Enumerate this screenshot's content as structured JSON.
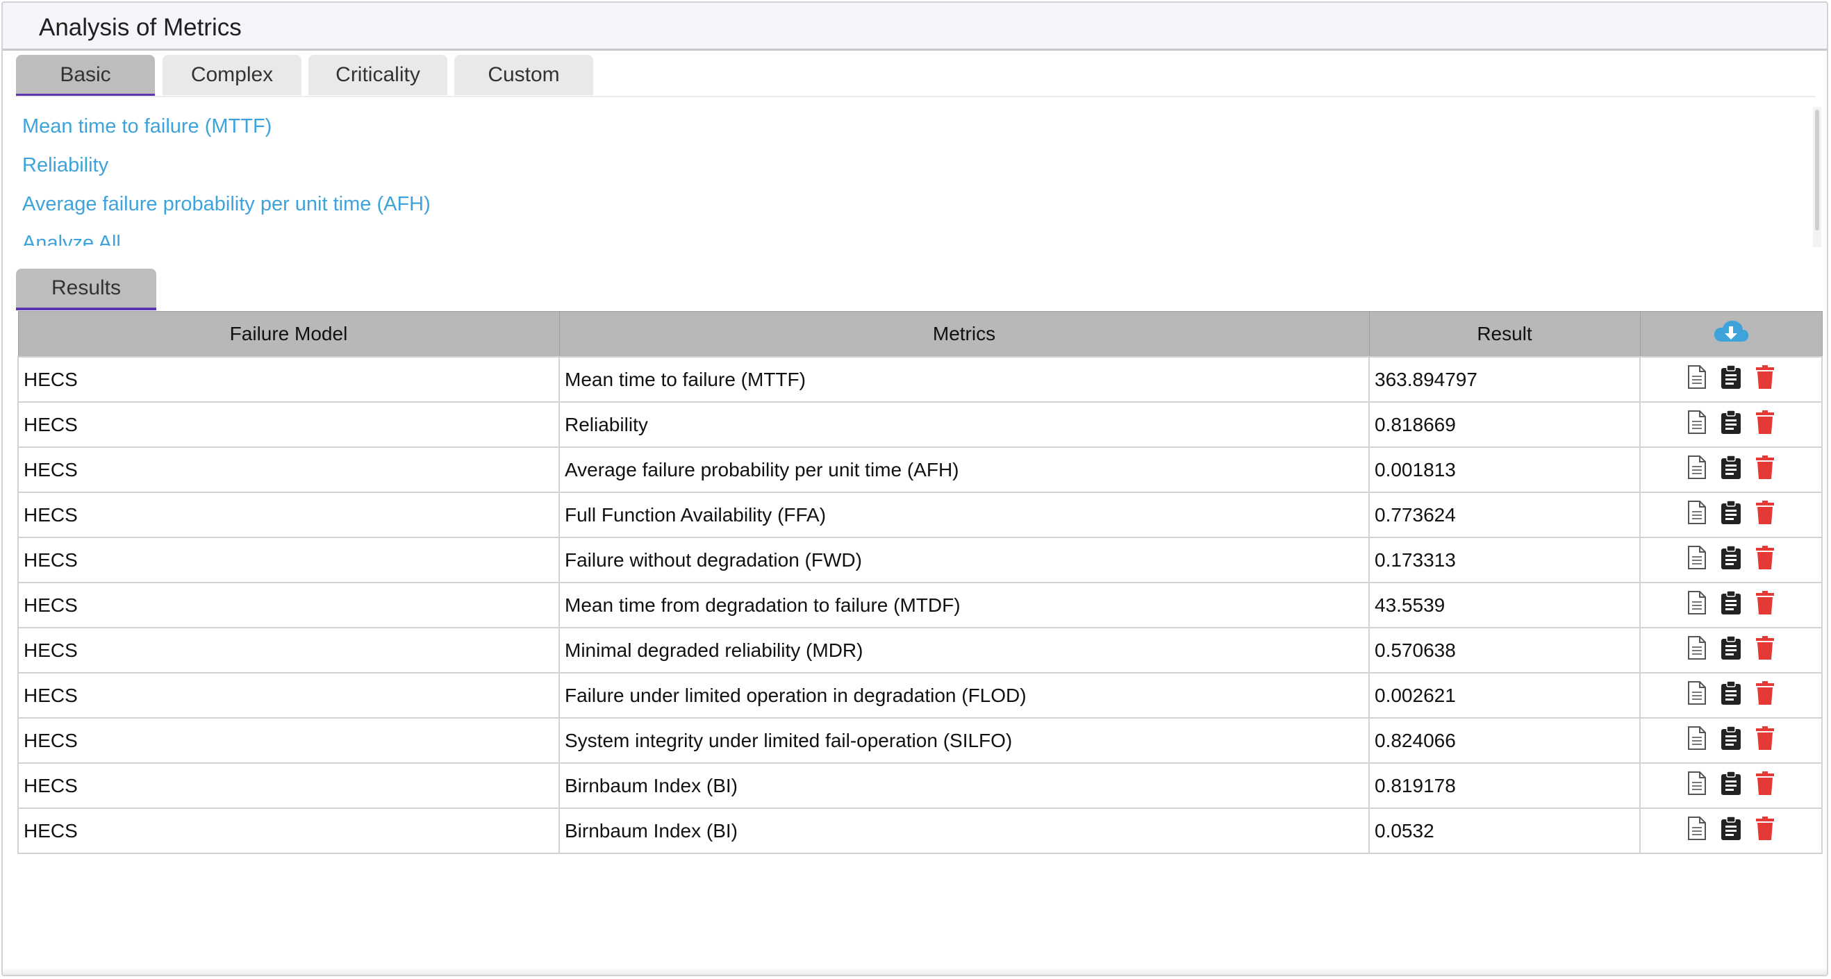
{
  "window": {
    "title": "Analysis of Metrics"
  },
  "tabs": [
    {
      "label": "Basic",
      "active": true
    },
    {
      "label": "Complex",
      "active": false
    },
    {
      "label": "Criticality",
      "active": false
    },
    {
      "label": "Custom",
      "active": false
    }
  ],
  "metric_links": [
    "Mean time to failure (MTTF)",
    "Reliability",
    "Average failure probability per unit time (AFH)",
    "Analyze All"
  ],
  "results_tab": {
    "label": "Results"
  },
  "table": {
    "headers": {
      "failure_model": "Failure Model",
      "metrics": "Metrics",
      "result": "Result",
      "download_icon": "cloud-download-icon"
    },
    "rows": [
      {
        "model": "HECS",
        "metric": "Mean time to failure (MTTF)",
        "result": "363.894797"
      },
      {
        "model": "HECS",
        "metric": "Reliability",
        "result": "0.818669"
      },
      {
        "model": "HECS",
        "metric": "Average failure probability per unit time (AFH)",
        "result": "0.001813"
      },
      {
        "model": "HECS",
        "metric": "Full Function Availability (FFA)",
        "result": "0.773624"
      },
      {
        "model": "HECS",
        "metric": "Failure without degradation (FWD)",
        "result": "0.173313"
      },
      {
        "model": "HECS",
        "metric": "Mean time from degradation to failure (MTDF)",
        "result": "43.5539"
      },
      {
        "model": "HECS",
        "metric": "Minimal degraded reliability (MDR)",
        "result": "0.570638"
      },
      {
        "model": "HECS",
        "metric": "Failure under limited operation in degradation (FLOD)",
        "result": "0.002621"
      },
      {
        "model": "HECS",
        "metric": "System integrity under limited fail-operation (SILFO)",
        "result": "0.824066"
      },
      {
        "model": "HECS",
        "metric": "Birnbaum Index (BI)",
        "result": "0.819178"
      },
      {
        "model": "HECS",
        "metric": "Birnbaum Index (BI)",
        "result": "0.0532"
      }
    ],
    "row_action_icons": [
      "document-icon",
      "clipboard-icon",
      "trash-icon"
    ]
  },
  "colors": {
    "link": "#3ea3db",
    "active_tab_underline": "#5e35b1",
    "delete_icon": "#e53935",
    "download_icon": "#3ea3db",
    "header_bg": "#b8b8b8"
  }
}
